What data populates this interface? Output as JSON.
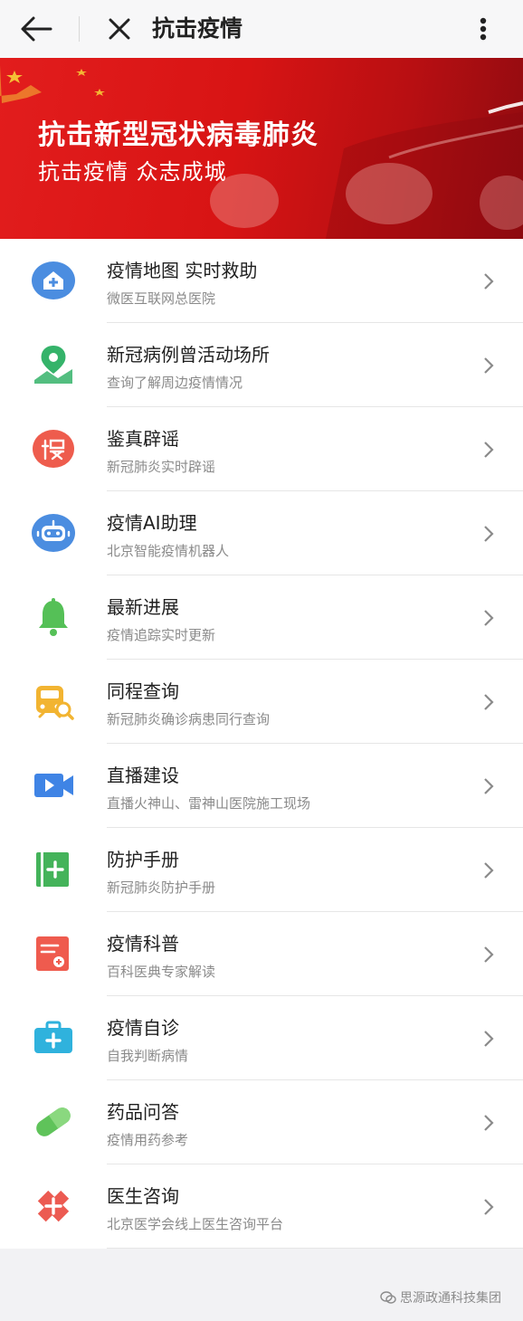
{
  "header": {
    "title": "抗击疫情"
  },
  "banner": {
    "title": "抗击新型冠状病毒肺炎",
    "subtitle": "抗击疫情  众志成城"
  },
  "items": [
    {
      "title": "疫情地图 实时救助",
      "subtitle": "微医互联网总医院",
      "icon": "hospital-icon",
      "color": "#4b8de0"
    },
    {
      "title": "新冠病例曾活动场所",
      "subtitle": "查询了解周边疫情情况",
      "icon": "location-pin-icon",
      "color": "#35b36a"
    },
    {
      "title": "鉴真辟谣",
      "subtitle": "新冠肺炎实时辟谣",
      "icon": "fake-icon",
      "color": "#ee5c4d"
    },
    {
      "title": "疫情AI助理",
      "subtitle": "北京智能疫情机器人",
      "icon": "robot-icon",
      "color": "#4b8de0"
    },
    {
      "title": "最新进展",
      "subtitle": "疫情追踪实时更新",
      "icon": "bell-icon",
      "color": "#55c057"
    },
    {
      "title": "同程查询",
      "subtitle": "新冠肺炎确诊病患同行查询",
      "icon": "train-search-icon",
      "color": "#f2b431"
    },
    {
      "title": "直播建设",
      "subtitle": "直播火神山、雷神山医院施工现场",
      "icon": "video-camera-icon",
      "color": "#3f84e5"
    },
    {
      "title": "防护手册",
      "subtitle": "新冠肺炎防护手册",
      "icon": "handbook-icon",
      "color": "#44b35a"
    },
    {
      "title": "疫情科普",
      "subtitle": "百科医典专家解读",
      "icon": "medical-book-icon",
      "color": "#ef5b4e"
    },
    {
      "title": "疫情自诊",
      "subtitle": "自我判断病情",
      "icon": "medical-kit-icon",
      "color": "#2fb2dd"
    },
    {
      "title": "药品问答",
      "subtitle": "疫情用药参考",
      "icon": "pill-icon",
      "color": "#5fc35a"
    },
    {
      "title": "医生咨询",
      "subtitle": "北京医学会线上医生咨询平台",
      "icon": "medical-cross-icon",
      "color": "#ec5b52"
    }
  ],
  "watermark": {
    "text": "思源政通科技集团"
  }
}
